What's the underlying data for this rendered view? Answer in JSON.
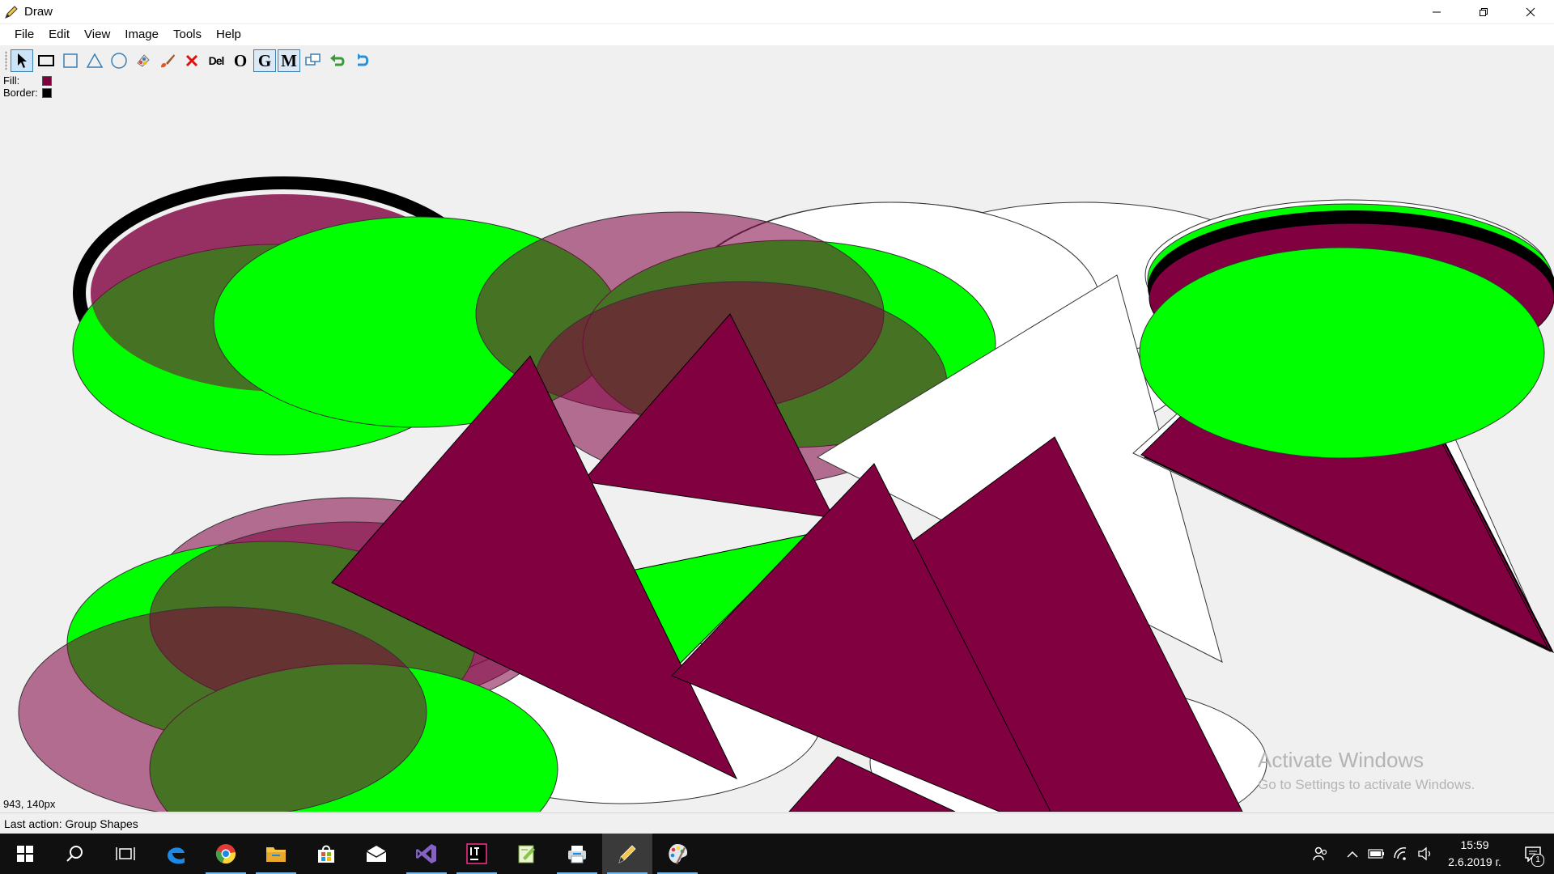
{
  "window": {
    "title": "Draw"
  },
  "menu": [
    "File",
    "Edit",
    "View",
    "Image",
    "Tools",
    "Help"
  ],
  "toolbar": {
    "tools": [
      {
        "name": "select-tool",
        "icon": "cursor-arrow-icon"
      },
      {
        "name": "rectangle-tool",
        "icon": "rectangle-icon"
      },
      {
        "name": "square-tool",
        "icon": "square-icon"
      },
      {
        "name": "triangle-tool",
        "icon": "triangle-icon"
      },
      {
        "name": "ellipse-tool",
        "icon": "ellipse-icon"
      },
      {
        "name": "fill-color-tool",
        "icon": "color-palette-icon"
      },
      {
        "name": "border-color-tool",
        "icon": "brush-icon"
      },
      {
        "name": "delete-tool",
        "icon": "red-x-icon"
      }
    ],
    "del_label": "Del",
    "o_label": "O",
    "g_label": "G",
    "m_label": "M"
  },
  "colors": {
    "fill_label": "Fill:",
    "fill": "#800040",
    "border_label": "Border:",
    "border": "#000000",
    "green": "#00ff00",
    "accent": "#76b9ed"
  },
  "canvas": {
    "cursor_coords": "943, 140px"
  },
  "status": {
    "last_action": "Last action: Group Shapes"
  },
  "watermark": {
    "title": "Activate Windows",
    "subtitle": "Go to Settings to activate Windows."
  },
  "taskbar": {
    "apps": [
      "windows-start-icon",
      "search-icon",
      "task-view-icon",
      "edge-icon",
      "chrome-icon",
      "file-explorer-icon",
      "store-icon",
      "mail-icon",
      "visual-studio-icon",
      "intellij-icon",
      "notepad-plus-icon",
      "printer-app-icon",
      "draw-pencil-icon",
      "paint-palette-icon"
    ],
    "time": "15:59",
    "date": "2.6.2019 г.",
    "notifications": "1"
  }
}
